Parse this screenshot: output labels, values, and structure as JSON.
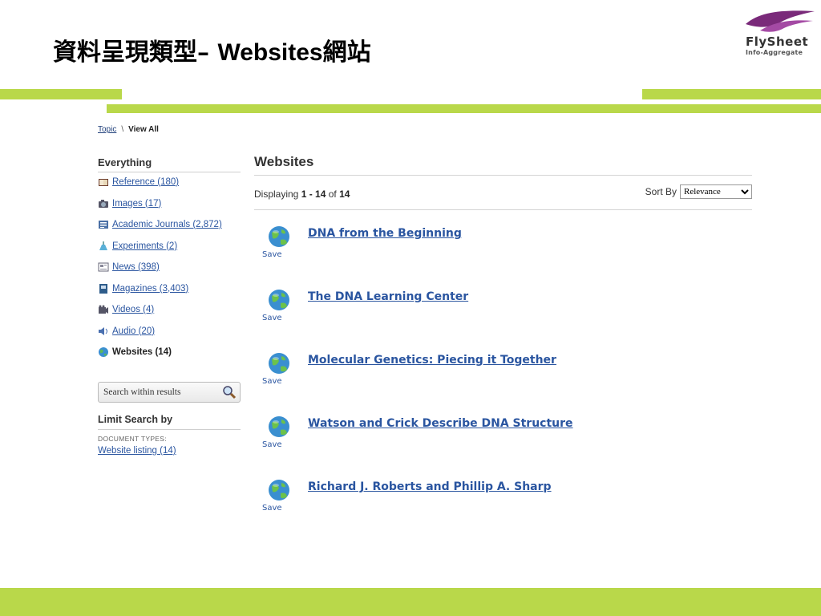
{
  "slide": {
    "title_cjk": "資料呈現類型",
    "title_dash": "– ",
    "title_latin": "Websites",
    "title_cjk2": "網站",
    "logo_brand": "FlySheet",
    "logo_tagline": "Info-Aggregate",
    "accent": "#b9d84a",
    "logo_color": "#7a2a7a"
  },
  "breadcrumb": {
    "topic": "Topic",
    "separator": "\\",
    "current": "View All"
  },
  "sidebar": {
    "heading": "Everything",
    "items": [
      {
        "icon": "reference-icon",
        "label": "Reference (180)"
      },
      {
        "icon": "camera-icon",
        "label": "Images (17)"
      },
      {
        "icon": "journal-icon",
        "label": "Academic Journals (2,872)"
      },
      {
        "icon": "flask-icon",
        "label": "Experiments (2)"
      },
      {
        "icon": "newspaper-icon",
        "label": "News (398)"
      },
      {
        "icon": "magazine-icon",
        "label": "Magazines (3,403)"
      },
      {
        "icon": "video-icon",
        "label": "Videos (4)"
      },
      {
        "icon": "audio-icon",
        "label": "Audio (20)"
      },
      {
        "icon": "globe-icon",
        "label": "Websites (14)"
      }
    ]
  },
  "search": {
    "placeholder": "Search within results"
  },
  "limit": {
    "heading": "Limit Search by",
    "doc_types_label": "DOCUMENT TYPES:",
    "link": "Website listing (14)"
  },
  "main": {
    "heading": "Websites",
    "displaying_prefix": "Displaying ",
    "range": "1 - 14",
    "of_text": " of ",
    "total": "14",
    "sort_label": "Sort By",
    "sort_value": "Relevance"
  },
  "results": [
    {
      "title": "DNA from the Beginning",
      "save": "Save"
    },
    {
      "title": "The DNA Learning Center",
      "save": "Save"
    },
    {
      "title": "Molecular Genetics: Piecing it Together",
      "save": "Save"
    },
    {
      "title": "Watson and Crick Describe DNA Structure",
      "save": "Save"
    },
    {
      "title": "Richard J. Roberts and Phillip A. Sharp",
      "save": "Save"
    }
  ]
}
